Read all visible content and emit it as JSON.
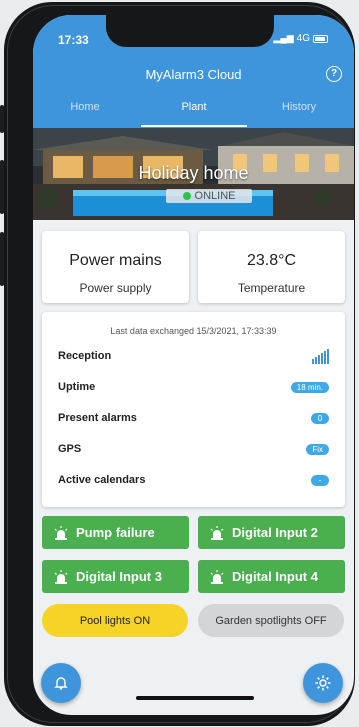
{
  "status": {
    "time": "17:33",
    "network": "4G"
  },
  "app": {
    "title": "MyAlarm3 Cloud"
  },
  "tabs": [
    {
      "label": "Home",
      "active": false
    },
    {
      "label": "Plant",
      "active": true
    },
    {
      "label": "History",
      "active": false
    }
  ],
  "site": {
    "name": "Holiday home",
    "status": "ONLINE"
  },
  "cards": {
    "power": {
      "value": "Power mains",
      "label": "Power supply"
    },
    "temperature": {
      "value": "23.8°C",
      "label": "Temperature"
    }
  },
  "info": {
    "last_data": "Last data exchanged 15/3/2021, 17:33:39",
    "rows": [
      {
        "label": "Reception"
      },
      {
        "label": "Uptime",
        "value": "18 min."
      },
      {
        "label": "Present alarms",
        "value": "0"
      },
      {
        "label": "GPS",
        "value": "Fix"
      },
      {
        "label": "Active calendars",
        "value": "-"
      }
    ]
  },
  "alarms": [
    "Pump failure",
    "Digital Input 2",
    "Digital Input 3",
    "Digital Input 4"
  ],
  "outputs": {
    "pool": "Pool lights ON",
    "garden": "Garden spotlights OFF"
  },
  "colors": {
    "primary": "#3f95db",
    "alarm_green": "#4caf4f",
    "on_yellow": "#f5d327",
    "off_gray": "#d3d5d7",
    "online_green": "#2fc24a"
  },
  "icons": [
    "bell-icon",
    "gear-icon",
    "siren-icon",
    "signal-icon",
    "help-icon"
  ]
}
